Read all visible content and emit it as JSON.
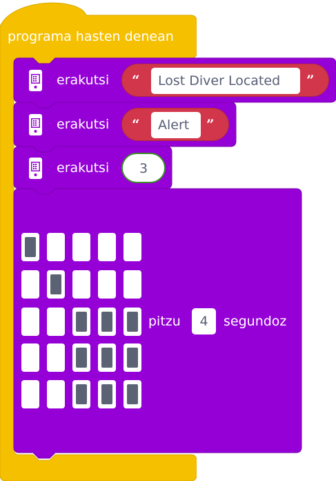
{
  "colors": {
    "event": "#f5c000",
    "basic": "#9500d6",
    "string": "#d2364b",
    "number_border": "#3e8e2a"
  },
  "on_start": {
    "label": "programa hasten denean"
  },
  "blocks": [
    {
      "label": "erakutsi",
      "icon": "microbit-icon",
      "quote_open": "“",
      "value": "Lost Diver Located",
      "quote_close": "”"
    },
    {
      "label": "erakutsi",
      "icon": "microbit-icon",
      "quote_open": "“",
      "value": "Alert",
      "quote_close": "”"
    },
    {
      "label": "erakutsi",
      "icon": "microbit-icon",
      "value": "3"
    }
  ],
  "leds": {
    "rows": [
      [
        1,
        0,
        0,
        0,
        0
      ],
      [
        0,
        1,
        0,
        0,
        0
      ],
      [
        0,
        0,
        1,
        1,
        1
      ],
      [
        0,
        0,
        1,
        1,
        1
      ],
      [
        0,
        0,
        1,
        1,
        1
      ]
    ],
    "pause_label": "pitzu",
    "pause_value": "4",
    "unit_label": "segundoz"
  }
}
